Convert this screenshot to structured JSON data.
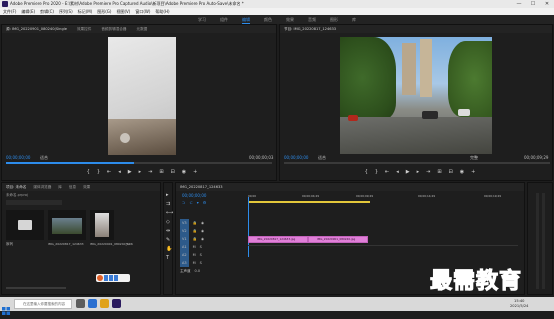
{
  "window": {
    "title": "Adobe Premiere Pro 2020 - E:\\素材\\Adobe Premiere Pro Captured Audio\\新项目\\Adobe Premiere Pro Auto-Save\\未命名 *",
    "min": "—",
    "max": "☐",
    "close": "✕"
  },
  "menu": [
    "文件(F)",
    "编辑(E)",
    "剪辑(C)",
    "序列(S)",
    "标记(M)",
    "图形(G)",
    "视图(V)",
    "窗口(W)",
    "帮助(H)"
  ],
  "workspaces": [
    "学习",
    "组件",
    "编辑",
    "颜色",
    "效果",
    "音频",
    "图形",
    "库"
  ],
  "source": {
    "tabs": [
      "源: IMG_20220901_080240(Single",
      "效果控件",
      "音频剪辑混合器",
      "元数据"
    ],
    "timecode_left": "00;00;00;00",
    "fit": "适合",
    "timecode_right": "00;00;00;03"
  },
  "program": {
    "tabs": [
      "节目: IMG_20220817_124633"
    ],
    "timecode_left": "00;00;00;00",
    "fit": "适合",
    "quality": "完整",
    "timecode_right": "00;00;09;29"
  },
  "project": {
    "tabs": [
      "项目: 未命名",
      "媒体浏览器",
      "库",
      "信息",
      "效果"
    ],
    "path": "未命名.prproj",
    "items": [
      {
        "name": "序列",
        "dur": ""
      },
      {
        "name": "IMG_20220817_124633",
        "dur": "5;29"
      },
      {
        "name": "IMG_20220901_080240_Si",
        "dur": "5;06"
      }
    ]
  },
  "timeline": {
    "tab": "IMG_20220817_124633",
    "timecode": "00;00;00;00",
    "ruler": [
      "00;00",
      "00;00;04;29",
      "00;00;09;29",
      "00;00;14;29",
      "00;00;19;29"
    ],
    "tracks": [
      "V3",
      "V2",
      "V1",
      "A1",
      "A2",
      "A3"
    ],
    "master": "主声道",
    "master_value": "0.0",
    "clips": [
      "IMG_20220817_124633.jpg",
      "IMG_20220901_080240.jpg"
    ]
  },
  "watermark": "最需教育",
  "taskbar": {
    "search_placeholder": "在这里输入你要搜索的内容",
    "time": "15:40",
    "date": "2021/5/24"
  },
  "colors": {
    "accent": "#2d8ceb",
    "clip": "#e07fd8",
    "timeline_bar": "#e3c73a"
  }
}
